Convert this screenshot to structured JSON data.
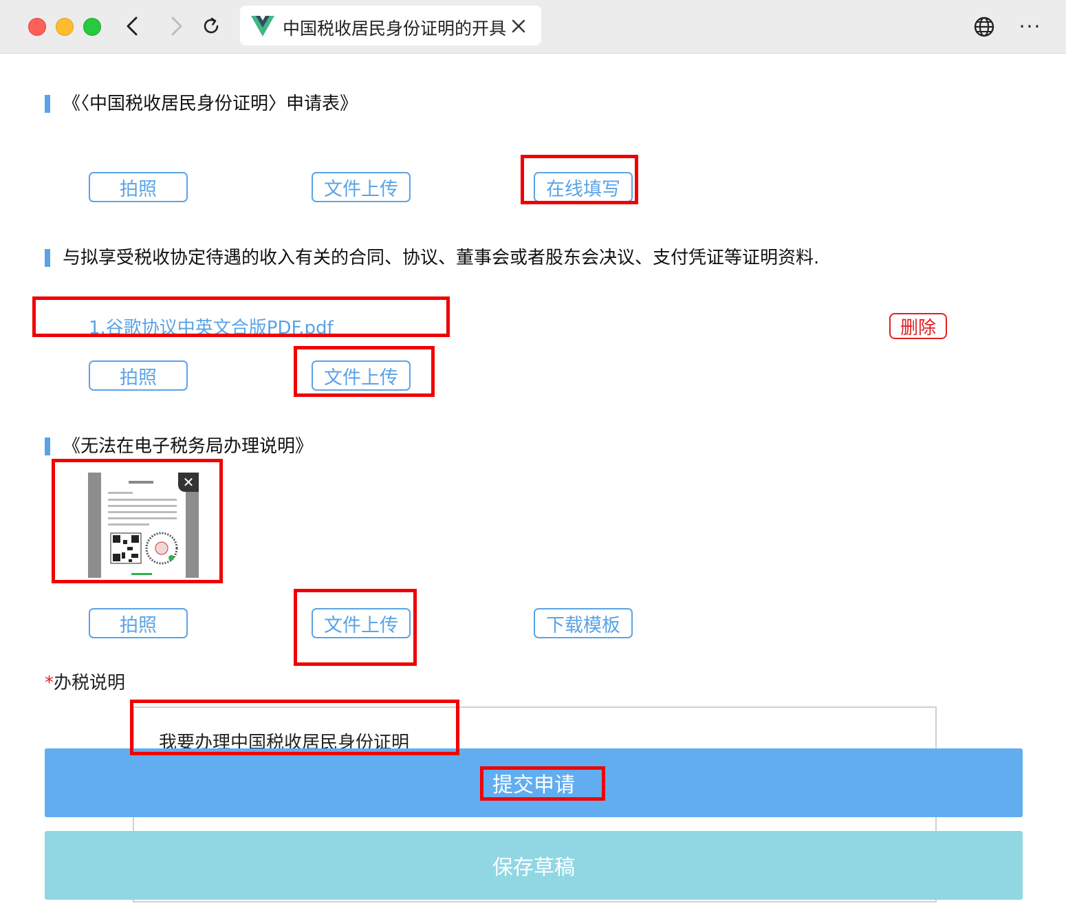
{
  "browser": {
    "tab_title": "中国税收居民身份证明的开具",
    "more_label": "···"
  },
  "sections": [
    {
      "title": "《〈中国税收居民身份证明〉申请表》",
      "buttons": [
        "拍照",
        "文件上传",
        "在线填写"
      ]
    },
    {
      "title": "与拟享受税收协定待遇的收入有关的合同、协议、董事会或者股东会决议、支付凭证等证明资料.",
      "file": {
        "name": "1.谷歌协议中英文合版PDF.pdf",
        "delete_label": "删除"
      },
      "buttons": [
        "拍照",
        "文件上传"
      ]
    },
    {
      "title": "《无法在电子税务局办理说明》",
      "buttons": [
        "拍照",
        "文件上传",
        "下载模板"
      ]
    }
  ],
  "tax_note": {
    "required_mark": "*",
    "label": "办税说明",
    "value": "我要办理中国税收居民身份证明"
  },
  "actions": {
    "submit_label": "提交申请",
    "draft_label": "保存草稿"
  },
  "colors": {
    "accent": "#5aa3e6",
    "submit": "#61adf0",
    "draft": "#90d7e3",
    "danger": "#e02020",
    "highlight": "#f00000"
  }
}
